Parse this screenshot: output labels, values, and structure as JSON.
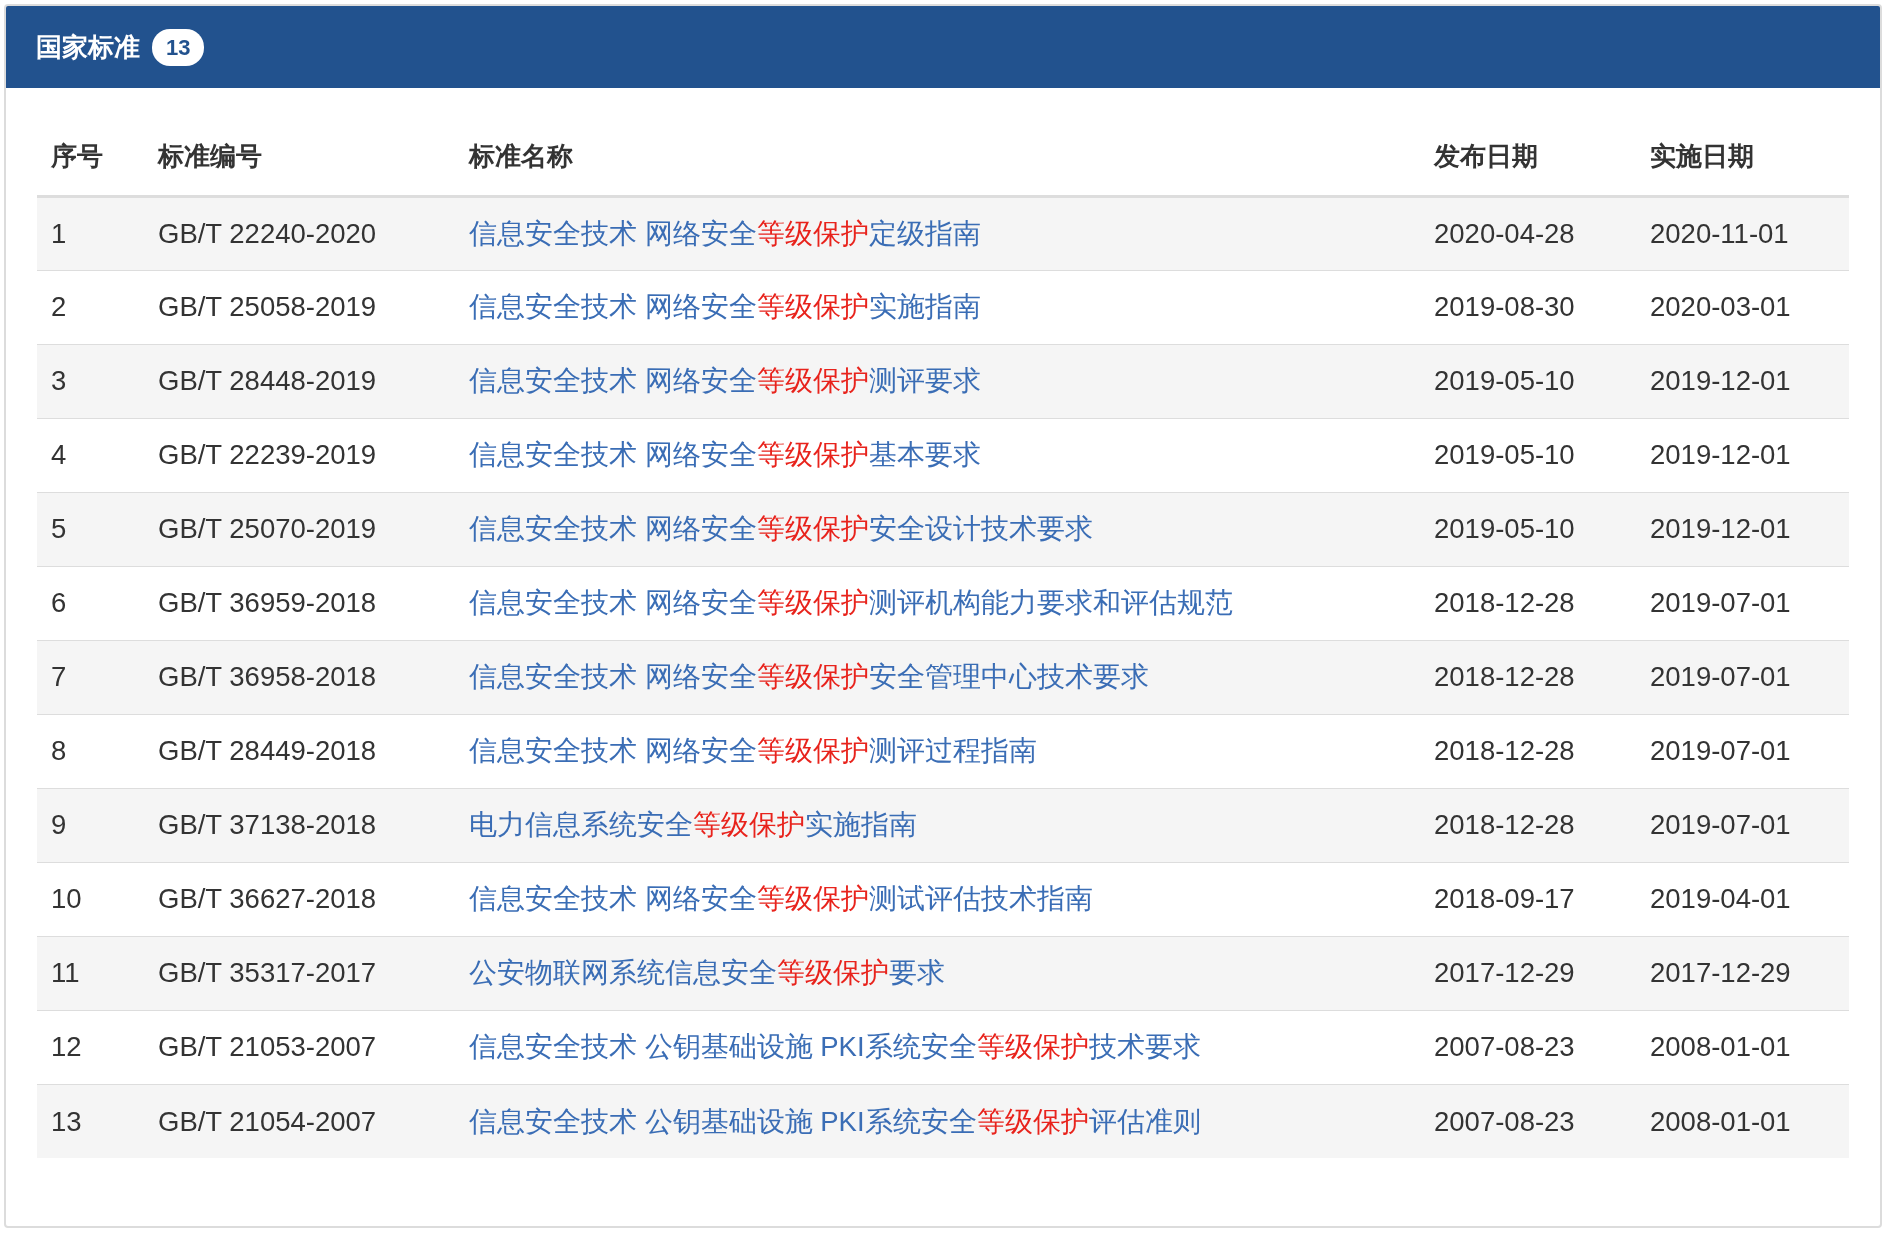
{
  "panel": {
    "title": "国家标准",
    "count": "13"
  },
  "table": {
    "columns": [
      "序号",
      "标准编号",
      "标准名称",
      "发布日期",
      "实施日期"
    ],
    "rows": [
      {
        "index": "1",
        "code": "GB/T 22240-2020",
        "name": [
          {
            "text": "信息安全技术 网络安全",
            "highlight": false
          },
          {
            "text": "等级保护",
            "highlight": true
          },
          {
            "text": "定级指南",
            "highlight": false
          }
        ],
        "published": "2020-04-28",
        "effective": "2020-11-01"
      },
      {
        "index": "2",
        "code": "GB/T 25058-2019",
        "name": [
          {
            "text": "信息安全技术 网络安全",
            "highlight": false
          },
          {
            "text": "等级保护",
            "highlight": true
          },
          {
            "text": "实施指南",
            "highlight": false
          }
        ],
        "published": "2019-08-30",
        "effective": "2020-03-01"
      },
      {
        "index": "3",
        "code": "GB/T 28448-2019",
        "name": [
          {
            "text": "信息安全技术 网络安全",
            "highlight": false
          },
          {
            "text": "等级保护",
            "highlight": true
          },
          {
            "text": "测评要求",
            "highlight": false
          }
        ],
        "published": "2019-05-10",
        "effective": "2019-12-01"
      },
      {
        "index": "4",
        "code": "GB/T 22239-2019",
        "name": [
          {
            "text": "信息安全技术 网络安全",
            "highlight": false
          },
          {
            "text": "等级保护",
            "highlight": true
          },
          {
            "text": "基本要求",
            "highlight": false
          }
        ],
        "published": "2019-05-10",
        "effective": "2019-12-01"
      },
      {
        "index": "5",
        "code": "GB/T 25070-2019",
        "name": [
          {
            "text": "信息安全技术 网络安全",
            "highlight": false
          },
          {
            "text": "等级保护",
            "highlight": true
          },
          {
            "text": "安全设计技术要求",
            "highlight": false
          }
        ],
        "published": "2019-05-10",
        "effective": "2019-12-01"
      },
      {
        "index": "6",
        "code": "GB/T 36959-2018",
        "name": [
          {
            "text": "信息安全技术 网络安全",
            "highlight": false
          },
          {
            "text": "等级保护",
            "highlight": true
          },
          {
            "text": "测评机构能力要求和评估规范",
            "highlight": false
          }
        ],
        "published": "2018-12-28",
        "effective": "2019-07-01"
      },
      {
        "index": "7",
        "code": "GB/T 36958-2018",
        "name": [
          {
            "text": "信息安全技术 网络安全",
            "highlight": false
          },
          {
            "text": "等级保护",
            "highlight": true
          },
          {
            "text": "安全管理中心技术要求",
            "highlight": false
          }
        ],
        "published": "2018-12-28",
        "effective": "2019-07-01"
      },
      {
        "index": "8",
        "code": "GB/T 28449-2018",
        "name": [
          {
            "text": "信息安全技术 网络安全",
            "highlight": false
          },
          {
            "text": "等级保护",
            "highlight": true
          },
          {
            "text": "测评过程指南",
            "highlight": false
          }
        ],
        "published": "2018-12-28",
        "effective": "2019-07-01"
      },
      {
        "index": "9",
        "code": "GB/T 37138-2018",
        "name": [
          {
            "text": "电力信息系统安全",
            "highlight": false
          },
          {
            "text": "等级保护",
            "highlight": true
          },
          {
            "text": "实施指南",
            "highlight": false
          }
        ],
        "published": "2018-12-28",
        "effective": "2019-07-01"
      },
      {
        "index": "10",
        "code": "GB/T 36627-2018",
        "name": [
          {
            "text": "信息安全技术 网络安全",
            "highlight": false
          },
          {
            "text": "等级保护",
            "highlight": true
          },
          {
            "text": "测试评估技术指南",
            "highlight": false
          }
        ],
        "published": "2018-09-17",
        "effective": "2019-04-01"
      },
      {
        "index": "11",
        "code": "GB/T 35317-2017",
        "name": [
          {
            "text": "公安物联网系统信息安全",
            "highlight": false
          },
          {
            "text": "等级保护",
            "highlight": true
          },
          {
            "text": "要求",
            "highlight": false
          }
        ],
        "published": "2017-12-29",
        "effective": "2017-12-29"
      },
      {
        "index": "12",
        "code": "GB/T 21053-2007",
        "name": [
          {
            "text": "信息安全技术 公钥基础设施 PKI系统安全",
            "highlight": false
          },
          {
            "text": "等级保护",
            "highlight": true
          },
          {
            "text": "技术要求",
            "highlight": false
          }
        ],
        "published": "2007-08-23",
        "effective": "2008-01-01"
      },
      {
        "index": "13",
        "code": "GB/T 21054-2007",
        "name": [
          {
            "text": "信息安全技术 公钥基础设施 PKI系统安全",
            "highlight": false
          },
          {
            "text": "等级保护",
            "highlight": true
          },
          {
            "text": "评估准则",
            "highlight": false
          }
        ],
        "published": "2007-08-23",
        "effective": "2008-01-01"
      }
    ]
  }
}
